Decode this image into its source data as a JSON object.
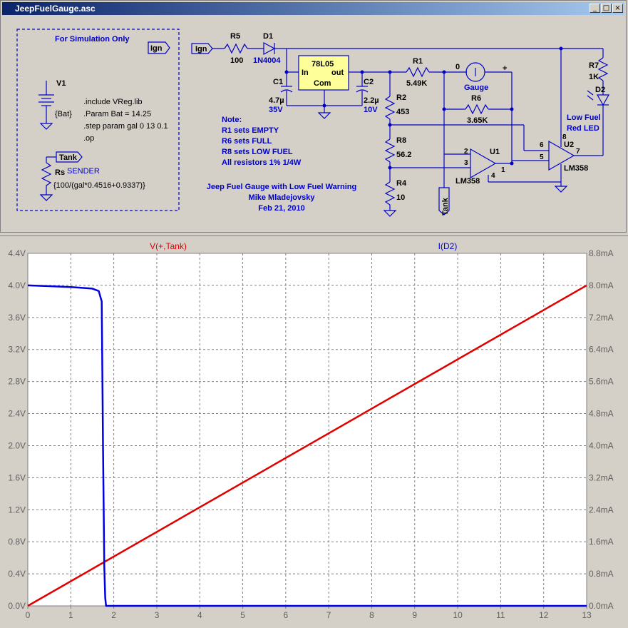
{
  "window": {
    "title": "JeepFuelGauge.asc",
    "buttons": {
      "minimize": "_",
      "maximize": "□",
      "close": "×"
    }
  },
  "schematic": {
    "sim_box": {
      "title": "For Simulation Only",
      "ign_label": "Ign",
      "v1": "V1",
      "v1_value": "{Bat}",
      "directives": [
        ".include VReg.lib",
        ".Param Bat = 14.25",
        ".step param gal 0 13 0.1",
        ".op"
      ],
      "tank_label": "Tank",
      "rs": "Rs",
      "rs_name": "SENDER",
      "rs_value": "{100/(gal*0.4516+0.9337)}"
    },
    "ign_port": "Ign",
    "r5": "R5",
    "r5_val": "100",
    "d1": "D1",
    "d1_val": "1N4004",
    "reg": {
      "name": "78L05",
      "in": "In",
      "out": "out",
      "com": "Com"
    },
    "c1": "C1",
    "c1_val1": "4.7µ",
    "c1_val2": "35V",
    "c2": "C2",
    "c2_val1": "2.2µ",
    "c2_val2": "10V",
    "r1": "R1",
    "r1_val": "5.49K",
    "r2": "R2",
    "r2_val": "453",
    "r8": "R8",
    "r8_val": "56.2",
    "r4": "R4",
    "r4_val": "10",
    "r6": "R6",
    "r6_val": "3.65K",
    "r7": "R7",
    "r7_val": "1K",
    "d2": "D2",
    "d2_val1": "Low Fuel",
    "d2_val2": "Red LED",
    "gauge": "Gauge",
    "gauge_zero": "0",
    "gauge_plus": "+",
    "u1": "U1",
    "u1_part": "LM358",
    "u2": "U2",
    "u2_part": "LM358",
    "pins": {
      "u1_in_neg": "2",
      "u1_in_pos": "3",
      "u1_out": "1",
      "u1_gnd": "4",
      "u2_vcc": "8",
      "u2_in_neg": "6",
      "u2_in_pos": "5",
      "u2_out": "7"
    },
    "tank_port": "Tank",
    "notes": [
      "Note:",
      "R1 sets EMPTY",
      "R6 sets FULL",
      "R8 sets LOW FUEL",
      "All resistors 1% 1/4W"
    ],
    "credit": [
      "Jeep Fuel Gauge with Low Fuel Warning",
      "Mike Mladejovsky",
      "Feb 21, 2010"
    ]
  },
  "colors": {
    "schematic_blue": "#0000c8",
    "trace1": "#e00000",
    "trace2": "#0000e0",
    "grid": "#808080",
    "reg_fill": "#ffff99"
  },
  "chart_data": {
    "type": "line",
    "x_ticks": [
      "0",
      "1",
      "2",
      "3",
      "4",
      "5",
      "6",
      "7",
      "8",
      "9",
      "10",
      "11",
      "12",
      "13"
    ],
    "xlim": [
      0,
      13
    ],
    "left_axis": {
      "ticks": [
        "0.0V",
        "0.4V",
        "0.8V",
        "1.2V",
        "1.6V",
        "2.0V",
        "2.4V",
        "2.8V",
        "3.2V",
        "3.6V",
        "4.0V",
        "4.4V"
      ],
      "ylim": [
        0,
        4.4
      ]
    },
    "right_axis": {
      "ticks": [
        "0.0mA",
        "0.8mA",
        "1.6mA",
        "2.4mA",
        "3.2mA",
        "4.0mA",
        "4.8mA",
        "5.6mA",
        "6.4mA",
        "7.2mA",
        "8.0mA",
        "8.8mA"
      ],
      "ylim": [
        0,
        8.8
      ]
    },
    "grid": true,
    "series": [
      {
        "name": "V(+,Tank)",
        "axis": "left",
        "color": "#e00000",
        "x": [
          0,
          13
        ],
        "y": [
          0,
          4.0
        ]
      },
      {
        "name": "I(D2)",
        "axis": "right",
        "color": "#0000e0",
        "x": [
          0,
          0.5,
          1.0,
          1.5,
          1.65,
          1.72,
          1.75,
          1.78,
          1.8,
          1.82,
          13
        ],
        "y": [
          8.0,
          7.98,
          7.96,
          7.92,
          7.86,
          7.6,
          4.0,
          1.0,
          0.2,
          0.0,
          0.0
        ]
      }
    ]
  }
}
